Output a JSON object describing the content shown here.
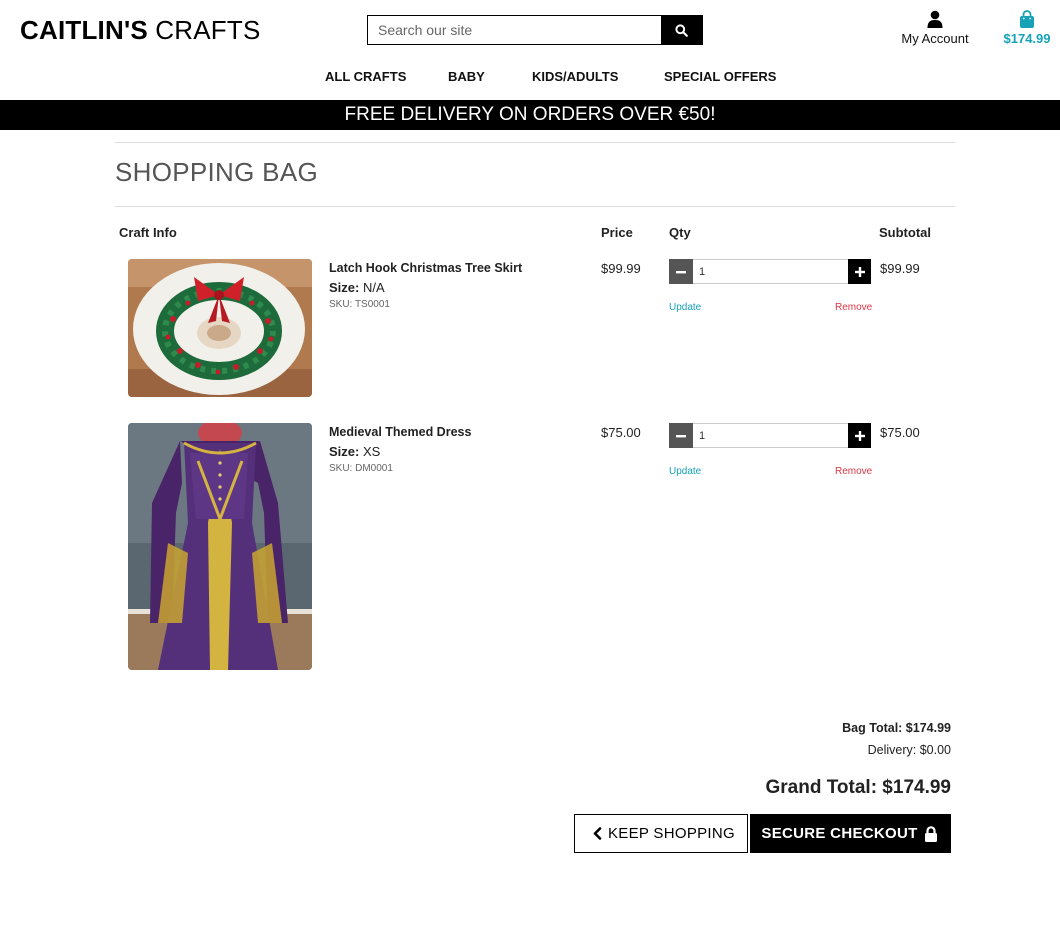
{
  "brand": {
    "logo_bold": "CAITLIN'S",
    "logo_light": " CRAFTS"
  },
  "search": {
    "placeholder": "Search our site",
    "icon": "search-icon"
  },
  "header": {
    "account_label": "My Account",
    "account_icon": "user-icon",
    "bag_total": "$174.99",
    "bag_icon": "shopping-bag-icon",
    "accent_color": "#17a2b8"
  },
  "nav": {
    "items": [
      "ALL CRAFTS",
      "BABY",
      "KIDS/ADULTS",
      "SPECIAL OFFERS"
    ]
  },
  "banner": {
    "text": "FREE DELIVERY ON ORDERS OVER €50!"
  },
  "page": {
    "title": "SHOPPING BAG"
  },
  "table": {
    "headers": {
      "info": "Craft Info",
      "price": "Price",
      "qty": "Qty",
      "subtotal": "Subtotal"
    }
  },
  "items": [
    {
      "name": "Latch Hook Christmas Tree Skirt",
      "size_label": "Size:",
      "size": "N/A",
      "sku": "SKU: TS0001",
      "price": "$99.99",
      "qty": "1",
      "subtotal": "$99.99",
      "update_label": "Update",
      "remove_label": "Remove"
    },
    {
      "name": "Medieval Themed Dress",
      "size_label": "Size:",
      "size": "XS",
      "sku": "SKU: DM0001",
      "price": "$75.00",
      "qty": "1",
      "subtotal": "$75.00",
      "update_label": "Update",
      "remove_label": "Remove"
    }
  ],
  "summary": {
    "bag_total": "Bag Total: $174.99",
    "delivery": "Delivery: $0.00",
    "grand_total": "Grand Total: $174.99"
  },
  "buttons": {
    "keep_shopping": "KEEP SHOPPING",
    "keep_shopping_icon": "chevron-left-icon",
    "secure_checkout": "SECURE CHECKOUT",
    "secure_checkout_icon": "lock-icon"
  },
  "colors": {
    "update_link": "#17a2b8",
    "remove_link": "#dc3545"
  }
}
